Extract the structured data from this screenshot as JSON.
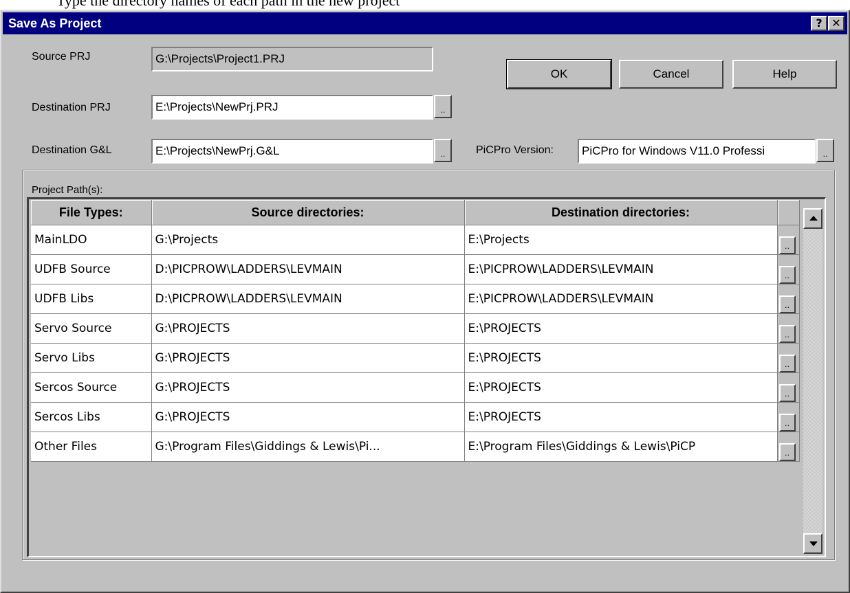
{
  "top_text": "Type the directory names of each path in the new project",
  "window": {
    "title": "Save As Project",
    "help_button": "?",
    "close_button": "✕"
  },
  "source_prj": {
    "label": "Source PRJ",
    "value": "G:\\Projects\\Project1.PRJ"
  },
  "destination_prj": {
    "label": "Destination PRJ",
    "value": "E:\\Projects\\NewPrj.PRJ"
  },
  "destination_gl": {
    "label": "Destination G&L",
    "value": "E:\\Projects\\NewPrj.G&L"
  },
  "picpro_version": {
    "label": "PiCPro Version:",
    "value": "PiCPro for Windows V11.0 Professi"
  },
  "browse_label": "..",
  "buttons": {
    "ok": "OK",
    "cancel": "Cancel",
    "help": "Help"
  },
  "group_label": "Project Path(s):",
  "table": {
    "headers": [
      "File Types:",
      "Source directories:",
      "Destination directories:"
    ],
    "rows": [
      [
        "MainLDO",
        "G:\\Projects",
        "E:\\Projects"
      ],
      [
        "UDFB Source",
        "D:\\PICPROW\\LADDERS\\LEVMAIN",
        "E:\\PICPROW\\LADDERS\\LEVMAIN"
      ],
      [
        "UDFB Libs",
        "D:\\PICPROW\\LADDERS\\LEVMAIN",
        "E:\\PICPROW\\LADDERS\\LEVMAIN"
      ],
      [
        "Servo Source",
        "G:\\PROJECTS",
        "E:\\PROJECTS"
      ],
      [
        "Servo Libs",
        "G:\\PROJECTS",
        "E:\\PROJECTS"
      ],
      [
        "Sercos Source",
        "G:\\PROJECTS",
        "E:\\PROJECTS"
      ],
      [
        "Sercos Libs",
        "G:\\PROJECTS",
        "E:\\PROJECTS"
      ],
      [
        "Other Files",
        "G:\\Program Files\\Giddings & Lewis\\Pi...",
        "E:\\Program Files\\Giddings & Lewis\\PiCP"
      ]
    ]
  },
  "scrollbar": {
    "up_icon": "scroll-up-arrow",
    "down_icon": "scroll-down-arrow"
  },
  "colors": {
    "titlebar": "#000080",
    "face": "#c0c0c0",
    "field": "#ffffff"
  }
}
